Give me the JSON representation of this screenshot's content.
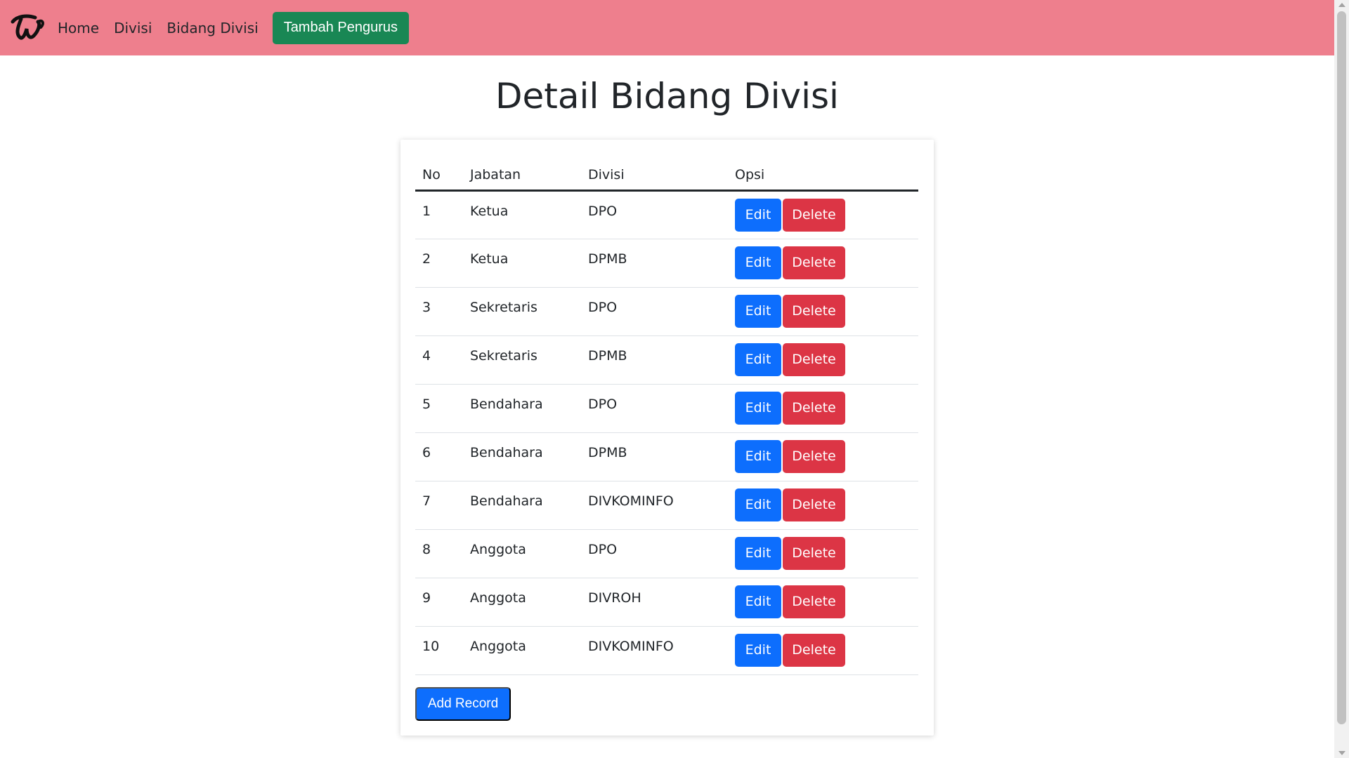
{
  "nav": {
    "logo_icon": "twice-logo-icon",
    "links": [
      "Home",
      "Divisi",
      "Bidang Divisi"
    ],
    "cta_label": "Tambah Pengurus",
    "bg_color": "#ee7f8d",
    "cta_color": "#198754"
  },
  "page": {
    "title": "Detail Bidang Divisi"
  },
  "table": {
    "headers": [
      "No",
      "Jabatan",
      "Divisi",
      "Opsi"
    ],
    "rows": [
      {
        "no": "1",
        "jabatan": "Ketua",
        "divisi": "DPO"
      },
      {
        "no": "2",
        "jabatan": "Ketua",
        "divisi": "DPMB"
      },
      {
        "no": "3",
        "jabatan": "Sekretaris",
        "divisi": "DPO"
      },
      {
        "no": "4",
        "jabatan": "Sekretaris",
        "divisi": "DPMB"
      },
      {
        "no": "5",
        "jabatan": "Bendahara",
        "divisi": "DPO"
      },
      {
        "no": "6",
        "jabatan": "Bendahara",
        "divisi": "DPMB"
      },
      {
        "no": "7",
        "jabatan": "Bendahara",
        "divisi": "DIVKOMINFO"
      },
      {
        "no": "8",
        "jabatan": "Anggota",
        "divisi": "DPO"
      },
      {
        "no": "9",
        "jabatan": "Anggota",
        "divisi": "DIVROH"
      },
      {
        "no": "10",
        "jabatan": "Anggota",
        "divisi": "DIVKOMINFO"
      }
    ],
    "edit_label": "Edit",
    "delete_label": "Delete",
    "edit_color": "#0d6efd",
    "delete_color": "#dc3545"
  },
  "add_record_label": "Add Record"
}
